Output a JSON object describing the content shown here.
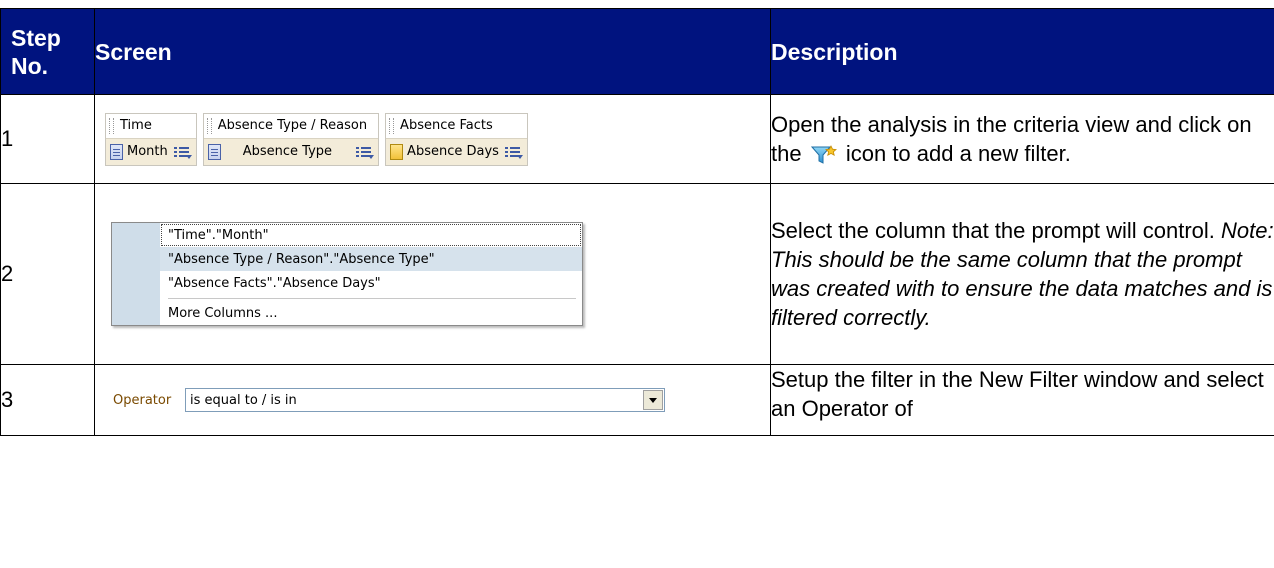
{
  "table": {
    "headers": {
      "step": "Step No.",
      "screen": "Screen",
      "description": "Description"
    },
    "rows": [
      {
        "step": "1",
        "criteria": [
          {
            "header": "Time",
            "column": "Month",
            "icon": "attribute-column-icon"
          },
          {
            "header": "Absence Type / Reason",
            "column": "Absence Type",
            "icon": "attribute-column-icon"
          },
          {
            "header": "Absence Facts",
            "column": "Absence Days",
            "icon": "measure-column-icon"
          }
        ],
        "desc_before": "Open the analysis in the criteria view and click on the",
        "desc_icon": "filter-add-icon",
        "desc_after": "icon to add a new filter."
      },
      {
        "step": "2",
        "menu": [
          "\"Time\".\"Month\"",
          "\"Absence Type / Reason\".\"Absence Type\"",
          "\"Absence Facts\".\"Absence Days\"",
          "More Columns ..."
        ],
        "desc_plain": "Select the column that the prompt will control.",
        "desc_note": "Note: This should be the same column that the prompt was created with to ensure the data matches and is filtered correctly."
      },
      {
        "step": "3",
        "operator_label": "Operator",
        "operator_value": "is equal to / is in",
        "desc": "Setup the filter in the New Filter window and select an Operator of"
      }
    ]
  },
  "colors": {
    "header_bg": "#00137f",
    "header_text": "#ffffff"
  }
}
